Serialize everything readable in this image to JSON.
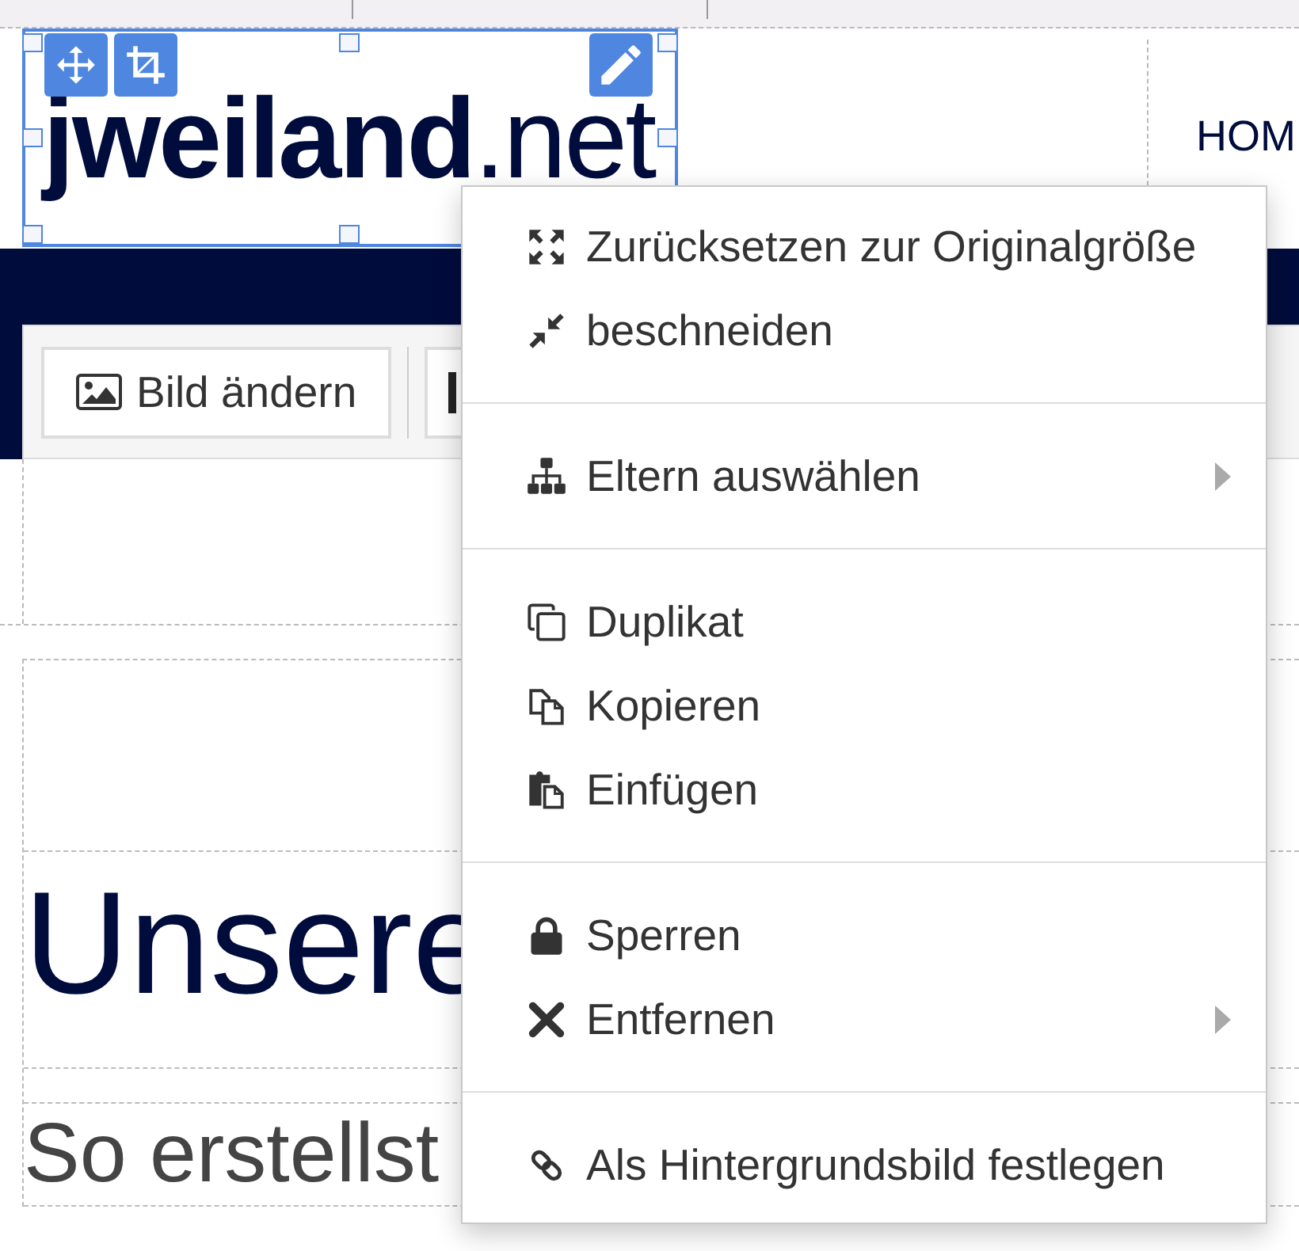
{
  "logo": {
    "text": "**jweiland**.net",
    "selected": true
  },
  "nav": [
    {
      "label": "HOM"
    }
  ],
  "toolbar": [
    {
      "kind": "labeled",
      "label": "Bild ändern"
    },
    {
      "kind": "icon"
    }
  ],
  "content": {
    "heading": "Unsere",
    "subheading": "So erstellst"
  },
  "context_menu": {
    "groups": [
      {
        "items": [
          {
            "label": "Zurücksetzen zur Originalgröße",
            "submenu": false
          },
          {
            "label": "beschneiden",
            "submenu": false
          }
        ]
      },
      {
        "items": [
          {
            "label": "Eltern auswählen",
            "submenu": true
          }
        ]
      },
      {
        "items": [
          {
            "label": "Duplikat",
            "submenu": false
          },
          {
            "label": "Kopieren",
            "submenu": false
          },
          {
            "label": "Einfügen",
            "submenu": false
          }
        ]
      },
      {
        "items": [
          {
            "label": "Sperren",
            "submenu": false
          },
          {
            "label": "Entfernen",
            "submenu": true
          }
        ]
      },
      {
        "items": [
          {
            "label": "Als Hintergrundsbild festlegen",
            "submenu": false
          }
        ]
      }
    ]
  }
}
